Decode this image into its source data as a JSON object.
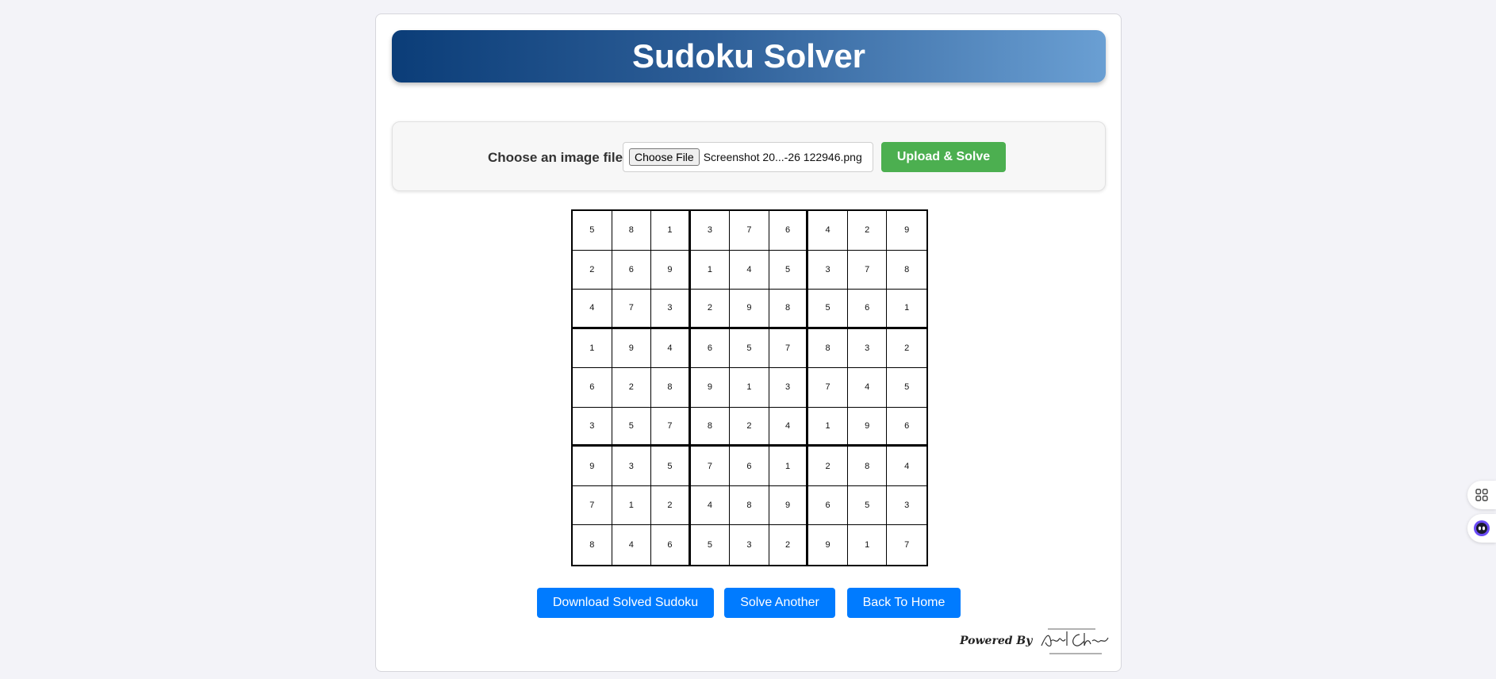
{
  "header": {
    "title": "Sudoku Solver"
  },
  "upload": {
    "label": "Choose an image file:",
    "choose_button": "Choose File",
    "file_name": "Screenshot 20...-26 122946.png",
    "submit_button": "Upload & Solve"
  },
  "grid": [
    [
      5,
      8,
      1,
      3,
      7,
      6,
      4,
      2,
      9
    ],
    [
      2,
      6,
      9,
      1,
      4,
      5,
      3,
      7,
      8
    ],
    [
      4,
      7,
      3,
      2,
      9,
      8,
      5,
      6,
      1
    ],
    [
      1,
      9,
      4,
      6,
      5,
      7,
      8,
      3,
      2
    ],
    [
      6,
      2,
      8,
      9,
      1,
      3,
      7,
      4,
      5
    ],
    [
      3,
      5,
      7,
      8,
      2,
      4,
      1,
      9,
      6
    ],
    [
      9,
      3,
      5,
      7,
      6,
      1,
      2,
      8,
      4
    ],
    [
      7,
      1,
      2,
      4,
      8,
      9,
      6,
      5,
      3
    ],
    [
      8,
      4,
      6,
      5,
      3,
      2,
      9,
      1,
      7
    ]
  ],
  "actions": {
    "download": "Download Solved Sudoku",
    "solve_another": "Solve Another",
    "back_home": "Back To Home"
  },
  "footer": {
    "powered_by": "Powered By",
    "signature": "Amit Chandra"
  },
  "side_tools": {
    "top_icon": "apps-grid-icon",
    "bottom_icon": "assistant-bot-icon"
  },
  "colors": {
    "banner_start": "#0b3d78",
    "banner_end": "#6a9fd3",
    "upload_button": "#4caf50",
    "action_button": "#007bff",
    "page_background": "#f3f3f8"
  }
}
